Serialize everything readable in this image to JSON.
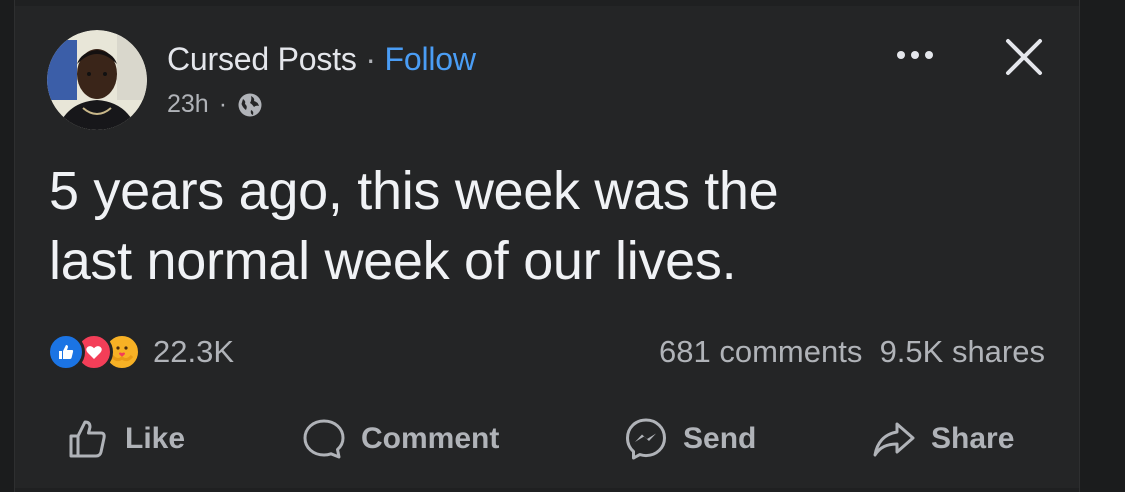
{
  "post": {
    "page_name": "Cursed Posts",
    "separator": " · ",
    "follow_label": "Follow",
    "time": "23h",
    "meta_dot": "·",
    "globe_icon": "globe-icon",
    "text_line1": "5 years ago, this week was the",
    "text_line2": "last normal week of our lives."
  },
  "stats": {
    "reaction_icons": [
      "like-reaction-icon",
      "love-reaction-icon",
      "care-reaction-icon"
    ],
    "reaction_count": "22.3K",
    "comments": "681 comments",
    "shares": "9.5K shares"
  },
  "actions": {
    "like": "Like",
    "comment": "Comment",
    "send": "Send",
    "share": "Share"
  },
  "colors": {
    "background": "#242526",
    "text": "#e4e6eb",
    "secondary": "#b0b3b8",
    "link": "#4a9df5",
    "like_blue": "#1b74e4",
    "love_red": "#f33e58",
    "care_yellow": "#f7b125"
  }
}
